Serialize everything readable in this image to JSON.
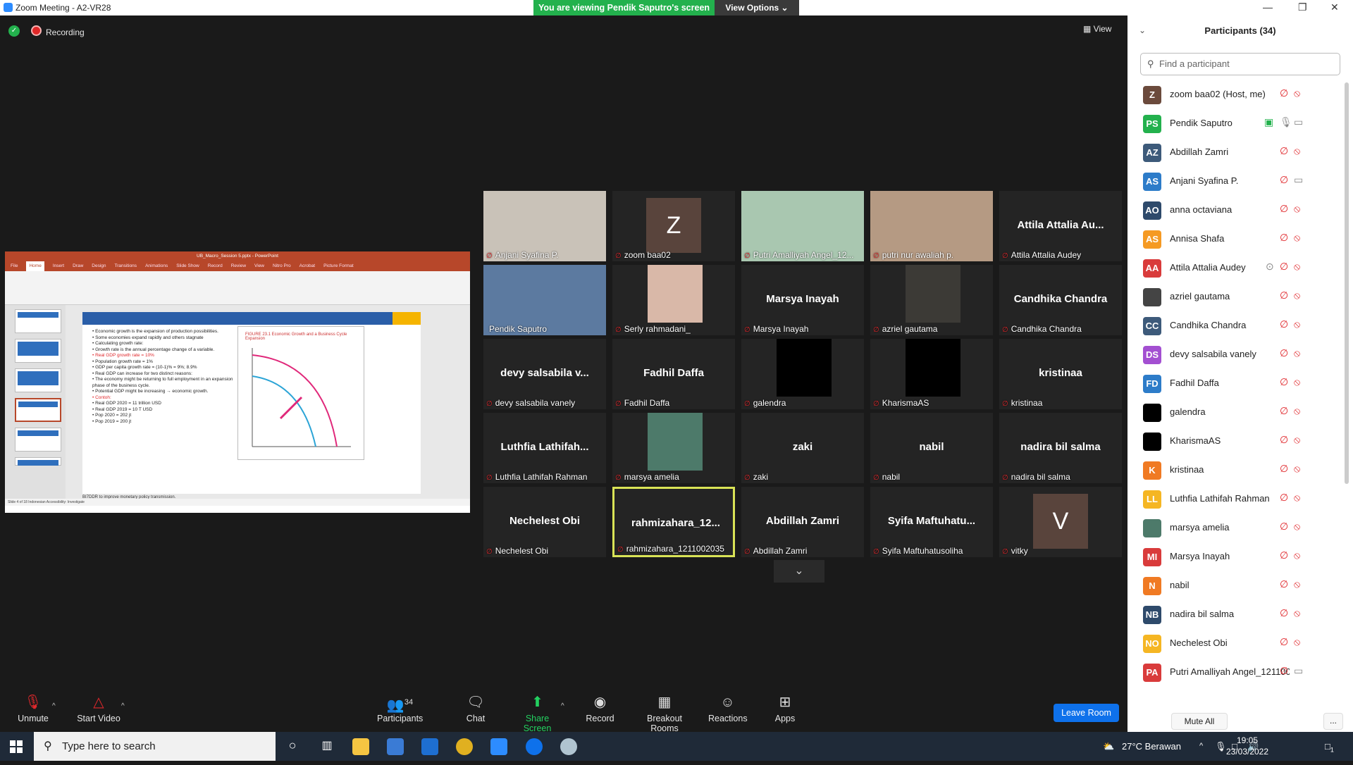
{
  "window": {
    "title": "Zoom Meeting - A2-VR28",
    "banner": "You are viewing Pendik Saputro's screen",
    "view_options": "View Options ⌄",
    "minimize": "—",
    "restore": "❐",
    "close": "✕"
  },
  "meeting": {
    "recording": "Recording",
    "view": "View"
  },
  "shared": {
    "ppt_title": "UB_Macro_Session 5.pptx - PowerPoint",
    "tabs": [
      "File",
      "Home",
      "Insert",
      "Draw",
      "Design",
      "Transitions",
      "Animations",
      "Slide Show",
      "Record",
      "Review",
      "View",
      "Nitro Pro",
      "Acrobat",
      "Picture Format"
    ],
    "slide_text": [
      {
        "t": "• Economic growth is the expansion of production possibilities.",
        "red": false
      },
      {
        "t": "   • Some economies expand rapidly and others stagnate",
        "red": false
      },
      {
        "t": "• Calculating growth rate:",
        "red": false
      },
      {
        "t": "   • Growth rate is the annual percentage change of a variable.",
        "red": false
      },
      {
        "t": "   • Real GDP growth rate = 10%",
        "red": true
      },
      {
        "t": "   • Population growth rate = 1%",
        "red": false
      },
      {
        "t": "   • GDP per capita growth rate = (10-1)% = 9%; 8.9%",
        "red": false
      },
      {
        "t": "• Real GDP can increase for two distinct reasons:",
        "red": false
      },
      {
        "t": "   • The economy might be returning to full employment in an expansion phase of the business cycle.",
        "red": false
      },
      {
        "t": "   • Potential GDP might be increasing → economic growth.",
        "red": false
      },
      {
        "t": "   • Contoh:",
        "red": true
      },
      {
        "t": "   • Real GDP 2020 = 11 trillion USD",
        "red": false
      },
      {
        "t": "   • Real GDP 2019 = 10 T USD",
        "red": false
      },
      {
        "t": "   • Pop 2020 = 202 jt",
        "red": false
      },
      {
        "t": "   • Pop 2019 = 200 jt",
        "red": false
      }
    ],
    "figure_label": "FIGURE 23.1  Economic Growth and a Business Cycle Expansion",
    "notes": "BI7DDR to improve monetary policy transmission.",
    "status": "Slide 4 of 18    Indonesian    Accessibility: Investigate"
  },
  "tiles": [
    {
      "name": "Anjani Syafina P.",
      "type": "video",
      "bg": "#c9c2b8",
      "muted": true
    },
    {
      "name": "zoom baa02",
      "type": "avatar",
      "letter": "Z",
      "muted": true
    },
    {
      "name": "Putri Amalliyah Angel_12...",
      "type": "video",
      "bg": "#a9c7b0",
      "muted": true
    },
    {
      "name": "putri nur awaliah p.",
      "type": "video",
      "bg": "#b59a83",
      "muted": true
    },
    {
      "name": "Attila Attalia Audey",
      "type": "name",
      "big": "Attila Attalia Au...",
      "muted": true
    },
    {
      "name": "Pendik Saputro",
      "type": "video",
      "bg": "#5c7aa0",
      "muted": false
    },
    {
      "name": "Serly rahmadani_",
      "type": "videosmall",
      "bg": "#d9b8a8",
      "muted": true
    },
    {
      "name": "Marsya Inayah",
      "type": "name",
      "big": "Marsya Inayah",
      "muted": true
    },
    {
      "name": "azriel gautama",
      "type": "videosmall",
      "bg": "#3c3a36",
      "muted": true
    },
    {
      "name": "Candhika Chandra",
      "type": "name",
      "big": "Candhika Chandra",
      "muted": true
    },
    {
      "name": "devy salsabila vanely",
      "type": "name",
      "big": "devy salsabila v...",
      "muted": true
    },
    {
      "name": "Fadhil Daffa",
      "type": "name",
      "big": "Fadhil Daffa",
      "muted": true
    },
    {
      "name": "galendra",
      "type": "videosmall",
      "bg": "#000000",
      "muted": true
    },
    {
      "name": "KharismaAS",
      "type": "videosmall",
      "bg": "#000000",
      "muted": true
    },
    {
      "name": "kristinaa",
      "type": "name",
      "big": "kristinaa",
      "muted": true
    },
    {
      "name": "Luthfia Lathifah Rahman",
      "type": "name",
      "big": "Luthfia  Lathifah...",
      "muted": true
    },
    {
      "name": "marsya amelia",
      "type": "videosmall",
      "bg": "#4d7a6a",
      "muted": true
    },
    {
      "name": "zaki",
      "type": "name",
      "big": "zaki",
      "muted": true
    },
    {
      "name": "nabil",
      "type": "name",
      "big": "nabil",
      "muted": true
    },
    {
      "name": "nadira bil salma",
      "type": "name",
      "big": "nadira bil salma",
      "muted": true
    },
    {
      "name": "Nechelest Obi",
      "type": "name",
      "big": "Nechelest Obi",
      "muted": true
    },
    {
      "name": "rahmizahara_1211002035",
      "type": "name",
      "big": "rahmizahara_12...",
      "muted": true,
      "speaking": true
    },
    {
      "name": "Abdillah Zamri",
      "type": "name",
      "big": "Abdillah Zamri",
      "muted": true
    },
    {
      "name": "Syifa Maftuhatusoliha",
      "type": "name",
      "big": "Syifa  Maftuhatu...",
      "muted": true
    },
    {
      "name": "vitky",
      "type": "avatar",
      "letter": "V",
      "muted": true
    }
  ],
  "toolbar": {
    "unmute": "Unmute",
    "start_video": "Start Video",
    "participants": "Participants",
    "participants_count": "34",
    "chat": "Chat",
    "share": "Share Screen",
    "record": "Record",
    "breakout": "Breakout Rooms",
    "reactions": "Reactions",
    "apps": "Apps",
    "leave": "Leave Room"
  },
  "panel": {
    "title": "Participants (34)",
    "search_placeholder": "Find a participant",
    "mute_all": "Mute All",
    "more": "...",
    "participants": [
      {
        "initials": "Z",
        "name": "zoom baa02 (Host, me)",
        "color": "#6b4a3c",
        "mic": "muted",
        "video": "off"
      },
      {
        "initials": "PS",
        "name": "Pendik Saputro",
        "color": "#23b14d",
        "mic": "on",
        "video": "on",
        "sharing": true
      },
      {
        "initials": "AZ",
        "name": "Abdillah Zamri",
        "color": "#3d5a7a",
        "mic": "muted",
        "video": "off"
      },
      {
        "initials": "AS",
        "name": "Anjani Syafina P.",
        "color": "#2d7cc9",
        "mic": "muted",
        "video": "on"
      },
      {
        "initials": "AO",
        "name": "anna octaviana",
        "color": "#2e4a6b",
        "mic": "muted",
        "video": "off"
      },
      {
        "initials": "AS",
        "name": "Annisa Shafa",
        "color": "#f59a23",
        "mic": "muted",
        "video": "off"
      },
      {
        "initials": "AA",
        "name": "Attila Attalia Audey",
        "color": "#d93b3b",
        "mic": "muted",
        "video": "off",
        "extra": true
      },
      {
        "initials": "",
        "name": "azriel gautama",
        "color": "#444444",
        "mic": "muted",
        "video": "off"
      },
      {
        "initials": "CC",
        "name": "Candhika Chandra",
        "color": "#3d5a7a",
        "mic": "muted",
        "video": "off"
      },
      {
        "initials": "DS",
        "name": "devy salsabila vanely",
        "color": "#a34fd1",
        "mic": "muted",
        "video": "off"
      },
      {
        "initials": "FD",
        "name": "Fadhil Daffa",
        "color": "#2d7cc9",
        "mic": "muted",
        "video": "off"
      },
      {
        "initials": "",
        "name": "galendra",
        "color": "#000000",
        "mic": "muted",
        "video": "off"
      },
      {
        "initials": "",
        "name": "KharismaAS",
        "color": "#000000",
        "mic": "muted",
        "video": "off"
      },
      {
        "initials": "K",
        "name": "kristinaa",
        "color": "#f07a23",
        "mic": "muted",
        "video": "off"
      },
      {
        "initials": "LL",
        "name": "Luthfia Lathifah Rahman",
        "color": "#f5b623",
        "mic": "muted",
        "video": "off"
      },
      {
        "initials": "",
        "name": "marsya amelia",
        "color": "#4d7a6a",
        "mic": "muted",
        "video": "off"
      },
      {
        "initials": "MI",
        "name": "Marsya Inayah",
        "color": "#d93b3b",
        "mic": "muted",
        "video": "off"
      },
      {
        "initials": "N",
        "name": "nabil",
        "color": "#f07a23",
        "mic": "muted",
        "video": "off"
      },
      {
        "initials": "NB",
        "name": "nadira bil salma",
        "color": "#2e4a6b",
        "mic": "muted",
        "video": "off"
      },
      {
        "initials": "NO",
        "name": "Nechelest Obi",
        "color": "#f5b623",
        "mic": "muted",
        "video": "off"
      },
      {
        "initials": "PA",
        "name": "Putri Amalliyah Angel_1211002...",
        "color": "#d93b3b",
        "mic": "muted",
        "video": "on"
      }
    ]
  },
  "taskbar": {
    "search": "Type here to search",
    "weather": "27°C  Berawan",
    "time": "19:05",
    "date": "23/03/2022",
    "notif": "1"
  },
  "colors": {
    "accent": "#0e71eb",
    "green": "#23b14d",
    "muted_red": "#e0282c"
  }
}
